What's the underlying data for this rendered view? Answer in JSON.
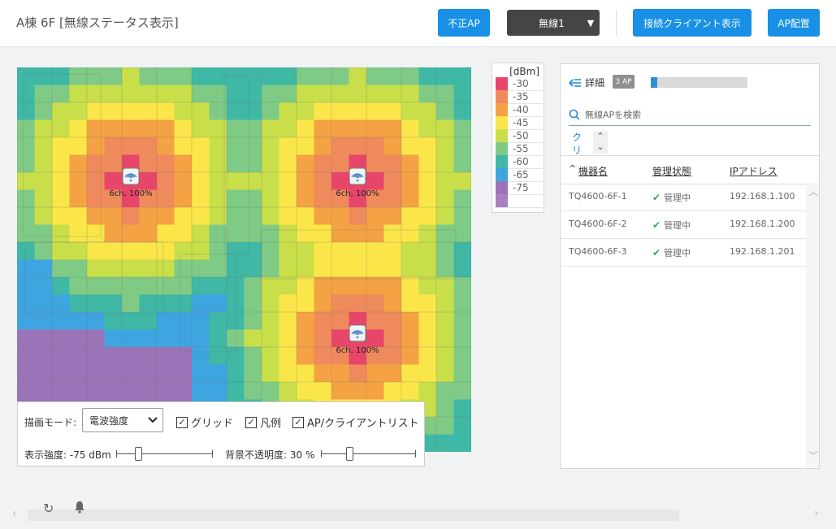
{
  "header": {
    "title": "A棟 6F [無線ステータス表示]",
    "rogue_ap_label": "不正AP",
    "radio_select_value": "無線1",
    "show_clients_label": "接続クライアント表示",
    "ap_placement_label": "AP配置"
  },
  "map": {
    "aps": [
      {
        "label": "6ch, 100%"
      },
      {
        "label": "6ch, 100%"
      },
      {
        "label": "6ch, 100%"
      }
    ]
  },
  "legend": {
    "unit": "[dBm]",
    "levels": [
      {
        "value": "-30",
        "color": "#e8456b"
      },
      {
        "value": "-35",
        "color": "#ef8a5d"
      },
      {
        "value": "-40",
        "color": "#f4a243"
      },
      {
        "value": "-45",
        "color": "#fbe64a"
      },
      {
        "value": "-50",
        "color": "#c9df4a"
      },
      {
        "value": "-55",
        "color": "#7fcb85"
      },
      {
        "value": "-60",
        "color": "#3fb8a6"
      },
      {
        "value": "-65",
        "color": "#3fa5e0"
      },
      {
        "value": "-75",
        "color": "#9b73b8"
      },
      {
        "value": "",
        "color": "#a87fbf"
      }
    ]
  },
  "controls": {
    "mode_label": "描画モード:",
    "mode_value": "電波強度",
    "grid_label": "グリッド",
    "legend_label": "凡例",
    "aplist_label": "AP/クライアントリスト",
    "strength_label": "表示強度: -75 dBm",
    "strength_level": 0.23,
    "opacity_label": "背景不透明度: 30 %",
    "opacity_level": 0.3
  },
  "panel": {
    "detail_label": "詳細",
    "ap_count": "3 AP",
    "progress": 0.07,
    "search_placeholder": "無線APを検索",
    "clear_label": "クリア",
    "columns": [
      "機器名",
      "管理状態",
      "IPアドレス"
    ],
    "rows": [
      {
        "name": "TQ4600-6F-1",
        "status": "管理中",
        "ip": "192.168.1.100"
      },
      {
        "name": "TQ4600-6F-2",
        "status": "管理中",
        "ip": "192.168.1.200"
      },
      {
        "name": "TQ4600-6F-3",
        "status": "管理中",
        "ip": "192.168.1.201"
      }
    ]
  }
}
